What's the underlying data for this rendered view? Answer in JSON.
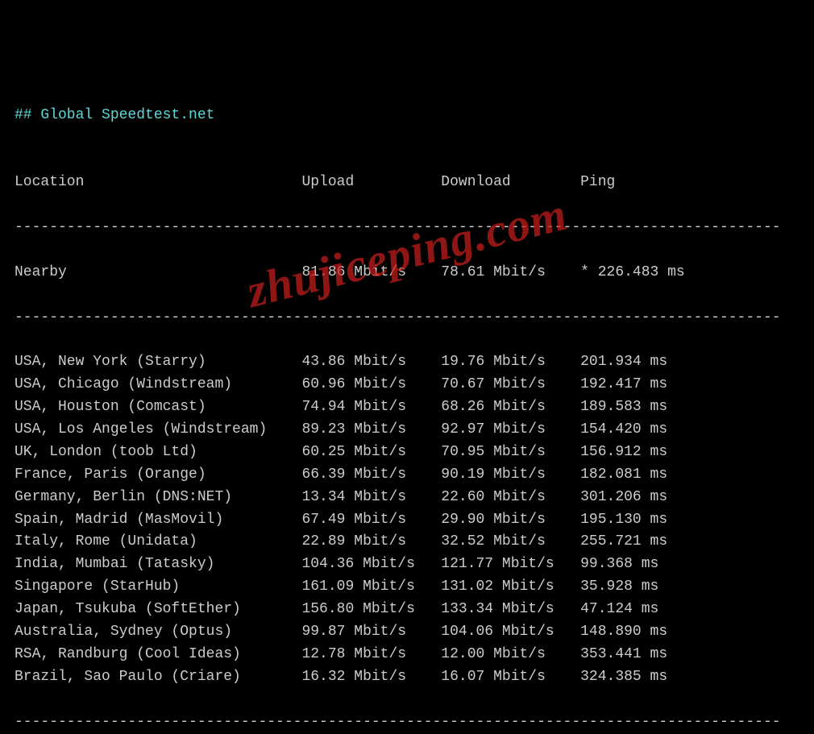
{
  "title": "## Global Speedtest.net",
  "watermark": "zhujiceping.com",
  "header": {
    "location": "Location",
    "upload": "Upload",
    "download": "Download",
    "ping": "Ping"
  },
  "nearby": {
    "location": "Nearby",
    "upload": "81.86 Mbit/s",
    "download": "78.61 Mbit/s",
    "ping": "* 226.483 ms"
  },
  "rows": [
    {
      "location": "USA, New York (Starry)",
      "upload": "43.86 Mbit/s",
      "download": "19.76 Mbit/s",
      "ping": "201.934 ms"
    },
    {
      "location": "USA, Chicago (Windstream)",
      "upload": "60.96 Mbit/s",
      "download": "70.67 Mbit/s",
      "ping": "192.417 ms"
    },
    {
      "location": "USA, Houston (Comcast)",
      "upload": "74.94 Mbit/s",
      "download": "68.26 Mbit/s",
      "ping": "189.583 ms"
    },
    {
      "location": "USA, Los Angeles (Windstream)",
      "upload": "89.23 Mbit/s",
      "download": "92.97 Mbit/s",
      "ping": "154.420 ms"
    },
    {
      "location": "UK, London (toob Ltd)",
      "upload": "60.25 Mbit/s",
      "download": "70.95 Mbit/s",
      "ping": "156.912 ms"
    },
    {
      "location": "France, Paris (Orange)",
      "upload": "66.39 Mbit/s",
      "download": "90.19 Mbit/s",
      "ping": "182.081 ms"
    },
    {
      "location": "Germany, Berlin (DNS:NET)",
      "upload": "13.34 Mbit/s",
      "download": "22.60 Mbit/s",
      "ping": "301.206 ms"
    },
    {
      "location": "Spain, Madrid (MasMovil)",
      "upload": "67.49 Mbit/s",
      "download": "29.90 Mbit/s",
      "ping": "195.130 ms"
    },
    {
      "location": "Italy, Rome (Unidata)",
      "upload": "22.89 Mbit/s",
      "download": "32.52 Mbit/s",
      "ping": "255.721 ms"
    },
    {
      "location": "India, Mumbai (Tatasky)",
      "upload": "104.36 Mbit/s",
      "download": "121.77 Mbit/s",
      "ping": "99.368 ms"
    },
    {
      "location": "Singapore (StarHub)",
      "upload": "161.09 Mbit/s",
      "download": "131.02 Mbit/s",
      "ping": "35.928 ms"
    },
    {
      "location": "Japan, Tsukuba (SoftEther)",
      "upload": "156.80 Mbit/s",
      "download": "133.34 Mbit/s",
      "ping": "47.124 ms"
    },
    {
      "location": "Australia, Sydney (Optus)",
      "upload": "99.87 Mbit/s",
      "download": "104.06 Mbit/s",
      "ping": "148.890 ms"
    },
    {
      "location": "RSA, Randburg (Cool Ideas)",
      "upload": "12.78 Mbit/s",
      "download": "12.00 Mbit/s",
      "ping": "353.441 ms"
    },
    {
      "location": "Brazil, Sao Paulo (Criare)",
      "upload": "16.32 Mbit/s",
      "download": "16.07 Mbit/s",
      "ping": "324.385 ms"
    }
  ],
  "columns": {
    "location_w": 33,
    "upload_w": 16,
    "download_w": 16
  }
}
